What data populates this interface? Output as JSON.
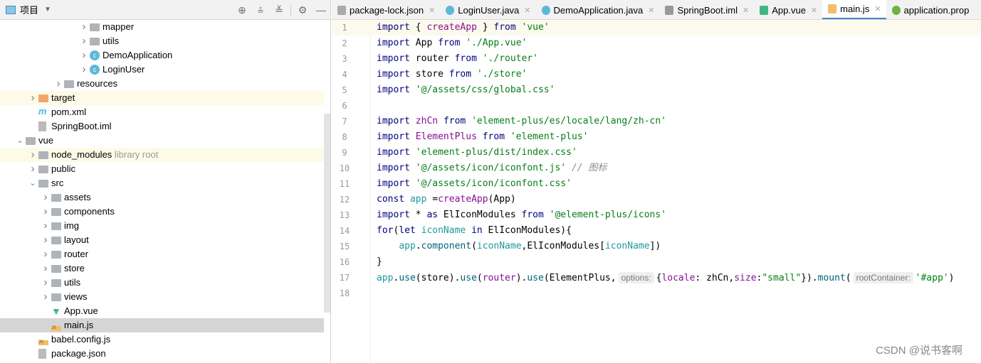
{
  "project_panel": {
    "title": "项目",
    "toolbar_icons": [
      "locate-icon",
      "expand-all-icon",
      "collapse-all-icon",
      "gear-icon",
      "minimize-icon"
    ],
    "tree": [
      {
        "label": "mapper",
        "level": 6,
        "icon": "folder",
        "chevron": "right"
      },
      {
        "label": "utils",
        "level": 6,
        "icon": "folder",
        "chevron": "right"
      },
      {
        "label": "DemoApplication",
        "level": 6,
        "icon": "class-run",
        "chevron": "right"
      },
      {
        "label": "LoginUser",
        "level": 6,
        "icon": "class",
        "chevron": "right"
      },
      {
        "label": "resources",
        "level": 4,
        "icon": "resources-folder",
        "chevron": "right"
      },
      {
        "label": "target",
        "level": 2,
        "icon": "orange-folder",
        "chevron": "right",
        "highlight": "#fdfbe7"
      },
      {
        "label": "pom.xml",
        "level": 2,
        "icon": "maven"
      },
      {
        "label": "SpringBoot.iml",
        "level": 2,
        "icon": "iml-file"
      },
      {
        "label": "vue",
        "level": 1,
        "icon": "folder",
        "chevron": "down"
      },
      {
        "label": "node_modules",
        "hint": "library root",
        "level": 2,
        "icon": "folder",
        "chevron": "right",
        "highlight": "#fdfbe7"
      },
      {
        "label": "public",
        "level": 2,
        "icon": "folder",
        "chevron": "right"
      },
      {
        "label": "src",
        "level": 2,
        "icon": "folder",
        "chevron": "down"
      },
      {
        "label": "assets",
        "level": 3,
        "icon": "folder",
        "chevron": "right"
      },
      {
        "label": "components",
        "level": 3,
        "icon": "folder",
        "chevron": "right"
      },
      {
        "label": "img",
        "level": 3,
        "icon": "folder",
        "chevron": "right"
      },
      {
        "label": "layout",
        "level": 3,
        "icon": "folder",
        "chevron": "right"
      },
      {
        "label": "router",
        "level": 3,
        "icon": "folder",
        "chevron": "right"
      },
      {
        "label": "store",
        "level": 3,
        "icon": "folder",
        "chevron": "right"
      },
      {
        "label": "utils",
        "level": 3,
        "icon": "folder",
        "chevron": "right"
      },
      {
        "label": "views",
        "level": 3,
        "icon": "folder",
        "chevron": "right"
      },
      {
        "label": "App.vue",
        "level": 3,
        "icon": "vue-file"
      },
      {
        "label": "main.js",
        "level": 3,
        "icon": "js-file",
        "selected": true
      },
      {
        "label": "babel.config.js",
        "level": 2,
        "icon": "js-file"
      },
      {
        "label": "package.json",
        "level": 2,
        "icon": "json-file"
      }
    ]
  },
  "tabs": [
    {
      "label": "package-lock.json",
      "icon": "json-file"
    },
    {
      "label": "LoginUser.java",
      "icon": "class"
    },
    {
      "label": "DemoApplication.java",
      "icon": "class-run"
    },
    {
      "label": "SpringBoot.iml",
      "icon": "iml-file"
    },
    {
      "label": "App.vue",
      "icon": "vue-file"
    },
    {
      "label": "main.js",
      "icon": "js-file",
      "active": true
    },
    {
      "label": "application.prop",
      "icon": "spring-file"
    }
  ],
  "editor": {
    "current_line": 1,
    "lines": [
      [
        [
          "import",
          "kw"
        ],
        [
          " { ",
          ""
        ],
        [
          "createApp",
          "fn"
        ],
        [
          " } ",
          ""
        ],
        [
          "from",
          "kw"
        ],
        [
          " ",
          ""
        ],
        [
          "'vue'",
          "str"
        ]
      ],
      [
        [
          "import",
          "kw"
        ],
        [
          " App ",
          ""
        ],
        [
          "from",
          "kw"
        ],
        [
          " ",
          ""
        ],
        [
          "'./App.vue'",
          "str"
        ]
      ],
      [
        [
          "import",
          "kw"
        ],
        [
          " router ",
          ""
        ],
        [
          "from",
          "kw"
        ],
        [
          " ",
          ""
        ],
        [
          "'./router'",
          "str"
        ]
      ],
      [
        [
          "import",
          "kw"
        ],
        [
          " store ",
          ""
        ],
        [
          "from",
          "kw"
        ],
        [
          " ",
          ""
        ],
        [
          "'./store'",
          "str"
        ]
      ],
      [
        [
          "import",
          "kw"
        ],
        [
          " ",
          ""
        ],
        [
          "'@/assets/css/global.css'",
          "str"
        ]
      ],
      [],
      [
        [
          "import",
          "kw"
        ],
        [
          " ",
          ""
        ],
        [
          "zhCn",
          "fn"
        ],
        [
          " ",
          ""
        ],
        [
          "from",
          "kw"
        ],
        [
          " ",
          ""
        ],
        [
          "'element-plus/es/locale/lang/zh-cn'",
          "str"
        ]
      ],
      [
        [
          "import",
          "kw"
        ],
        [
          " ",
          ""
        ],
        [
          "ElementPlus",
          "fn"
        ],
        [
          " ",
          ""
        ],
        [
          "from",
          "kw"
        ],
        [
          " ",
          ""
        ],
        [
          "'element-plus'",
          "str"
        ]
      ],
      [
        [
          "import",
          "kw"
        ],
        [
          " ",
          ""
        ],
        [
          "'element-plus/dist/index.css'",
          "str"
        ]
      ],
      [
        [
          "import",
          "kw"
        ],
        [
          " ",
          ""
        ],
        [
          "'@/assets/icon/iconfont.js'",
          "str"
        ],
        [
          " ",
          ""
        ],
        [
          "// 图标",
          "cm"
        ]
      ],
      [
        [
          "import",
          "kw"
        ],
        [
          " ",
          ""
        ],
        [
          "'@/assets/icon/iconfont.css'",
          "str"
        ]
      ],
      [
        [
          "const",
          "kw"
        ],
        [
          " ",
          ""
        ],
        [
          "app",
          "var"
        ],
        [
          " =",
          ""
        ],
        [
          "createApp",
          "fn"
        ],
        [
          "(App)",
          ""
        ]
      ],
      [
        [
          "import",
          "kw"
        ],
        [
          " * ",
          ""
        ],
        [
          "as",
          "kw"
        ],
        [
          " ElIconModules ",
          ""
        ],
        [
          "from",
          "kw"
        ],
        [
          " ",
          ""
        ],
        [
          "'@element-plus/icons'",
          "str"
        ]
      ],
      [
        [
          "for",
          "kw"
        ],
        [
          "(",
          ""
        ],
        [
          "let",
          "kw"
        ],
        [
          " ",
          ""
        ],
        [
          "iconName",
          "var"
        ],
        [
          " ",
          ""
        ],
        [
          "in",
          "kw"
        ],
        [
          " ElIconModules){",
          ""
        ]
      ],
      [
        [
          "    ",
          ""
        ],
        [
          "app",
          "var"
        ],
        [
          ".",
          ""
        ],
        [
          "component",
          "mt"
        ],
        [
          "(",
          ""
        ],
        [
          "iconName",
          "var"
        ],
        [
          ",ElIconModules[",
          ""
        ],
        [
          "iconName",
          "var"
        ],
        [
          "])",
          ""
        ]
      ],
      [
        [
          "}",
          ""
        ]
      ],
      [
        [
          "app",
          "var"
        ],
        [
          ".",
          ""
        ],
        [
          "use",
          "mt"
        ],
        [
          "(store).",
          ""
        ],
        [
          "use",
          "mt"
        ],
        [
          "(",
          ""
        ],
        [
          "router",
          "fn"
        ],
        [
          ").",
          ""
        ],
        [
          "use",
          "mt"
        ],
        [
          "(ElementPlus,",
          ""
        ],
        [
          "options:",
          "inlay"
        ],
        [
          "{",
          ""
        ],
        [
          "locale",
          "fn"
        ],
        [
          ": zhCn,",
          ""
        ],
        [
          "size",
          "fn"
        ],
        [
          ":",
          ""
        ],
        [
          "\"small\"",
          "str"
        ],
        [
          "}).",
          ""
        ],
        [
          "mount",
          "mt"
        ],
        [
          "(",
          ""
        ],
        [
          "rootContainer:",
          "inlay"
        ],
        [
          "'#app'",
          "str"
        ],
        [
          ")",
          ""
        ]
      ],
      []
    ]
  },
  "watermark": "CSDN @说书客啊"
}
